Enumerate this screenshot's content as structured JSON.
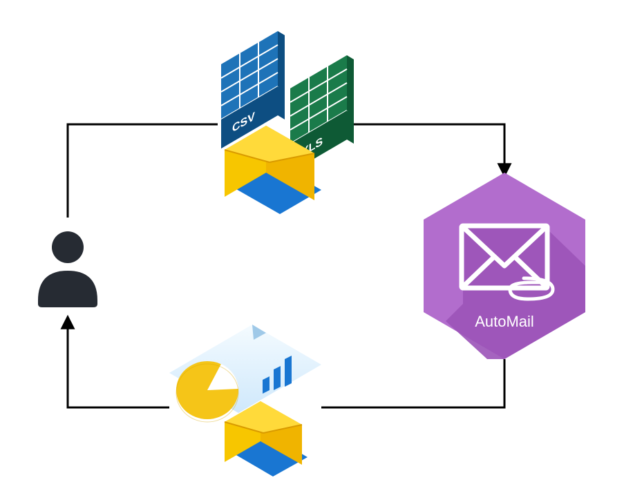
{
  "diagram": {
    "nodes": {
      "user": {
        "type": "person-icon"
      },
      "files": {
        "csv_label": "CSV",
        "xls_label": "XLS",
        "envelope": true
      },
      "automail": {
        "label": "AutoMail",
        "envelope_with_clip": true
      },
      "report": {
        "type": "pie-chart-document",
        "envelope": true
      }
    },
    "flow": [
      {
        "from": "user",
        "to": "files"
      },
      {
        "from": "files",
        "to": "automail"
      },
      {
        "from": "automail",
        "to": "report"
      },
      {
        "from": "report",
        "to": "user"
      }
    ],
    "colors": {
      "arrow": "#000000",
      "user": "#262b33",
      "csv": "#1e73b8",
      "xls": "#1a7b4a",
      "envelope_body": "#f7c600",
      "envelope_flap": "#f0b400",
      "automail_hex_light": "#b26dcd",
      "automail_hex_dark": "#9b53b8",
      "automail_shadow": "#8b46a7",
      "report_bg_top": "#e9f8ff",
      "report_bg_bottom": "#bfe2ff",
      "report_pie": "#f5c518",
      "report_bars": "#1976d2",
      "iso_shadow": "#1976d2"
    }
  }
}
